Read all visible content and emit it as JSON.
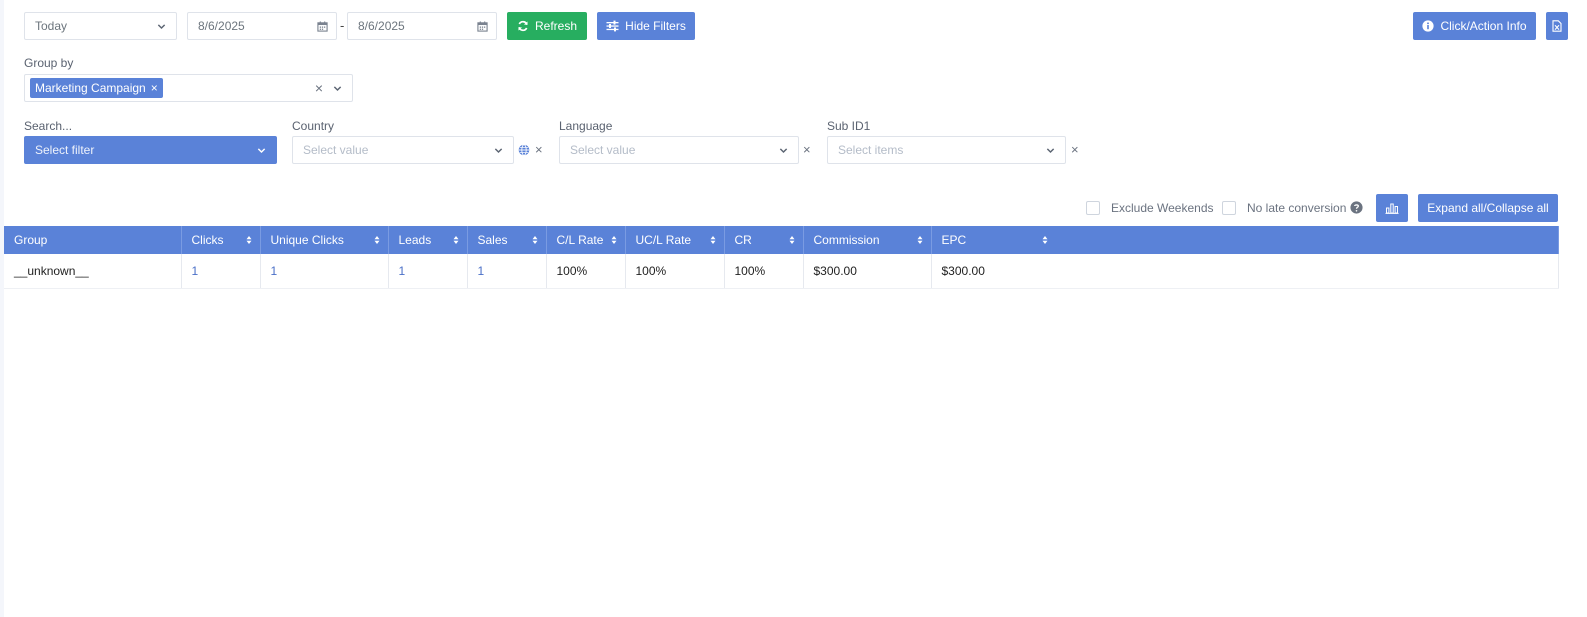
{
  "date_range": {
    "preset": "Today",
    "start": "8/6/2025",
    "separator": "-",
    "end": "8/6/2025"
  },
  "toolbar": {
    "refresh_label": "Refresh",
    "hide_filters_label": "Hide Filters",
    "click_info_label": "Click/Action Info"
  },
  "group_by": {
    "label": "Group by",
    "tag": "Marketing Campaign",
    "tag_remove": "×",
    "clear": "×"
  },
  "filters": {
    "search": {
      "label": "Search...",
      "value": "Select filter"
    },
    "country": {
      "label": "Country",
      "placeholder": "Select value",
      "clear": "×"
    },
    "language": {
      "label": "Language",
      "placeholder": "Select value",
      "clear": "×"
    },
    "subid": {
      "label": "Sub ID1",
      "placeholder": "Select items",
      "clear": "×"
    }
  },
  "options": {
    "exclude_weekends": "Exclude Weekends",
    "no_late_conversion": "No late conversion",
    "expand_label": "Expand all/Collapse all"
  },
  "table": {
    "columns": [
      "Group",
      "Clicks",
      "Unique Clicks",
      "Leads",
      "Sales",
      "C/L Rate",
      "UC/L Rate",
      "CR",
      "Commission",
      "EPC"
    ],
    "rows": [
      [
        "__unknown__",
        "1",
        "1",
        "1",
        "1",
        "100%",
        "100%",
        "100%",
        "$300.00",
        "$300.00"
      ]
    ]
  },
  "colors": {
    "primary": "#5a82d8",
    "success": "#27ae60",
    "link": "#4a6fc7"
  }
}
